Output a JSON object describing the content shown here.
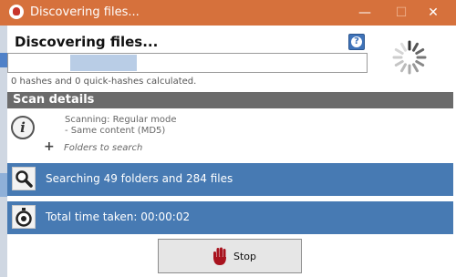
{
  "window": {
    "title": "Discovering files...",
    "min_glyph": "—",
    "max_glyph": "☐",
    "close_glyph": "✕"
  },
  "header": {
    "heading": "Discovering files...",
    "help_glyph": "?"
  },
  "progress": {
    "fraction": 0.19,
    "status": "0 hashes and 0 quick-hashes calculated."
  },
  "scan_details": {
    "title": "Scan details",
    "info_glyph": "i",
    "lines": [
      "Scanning: Regular mode",
      "- Same content (MD5)"
    ],
    "folders_link": "Folders to search"
  },
  "status_rows": [
    {
      "icon": "magnifier-icon",
      "text": "Searching 49 folders and 284 files"
    },
    {
      "icon": "stopwatch-icon",
      "text": "Total time taken: 00:00:02"
    }
  ],
  "stop_button": {
    "label": "Stop",
    "icon": "hand-icon"
  },
  "colors": {
    "titlebar": "#d6713c",
    "section_header": "#6b6b6b",
    "status_row": "#477ab3",
    "progress_fill": "#b9cde6"
  }
}
